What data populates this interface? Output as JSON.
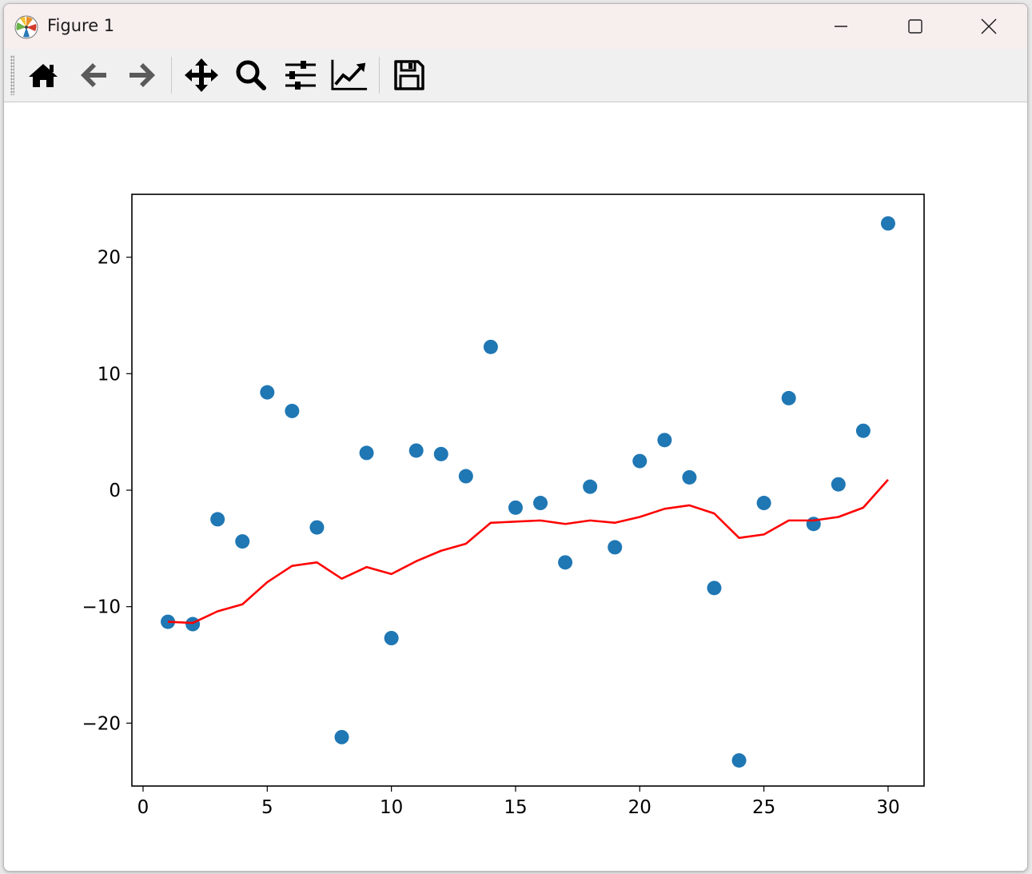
{
  "window": {
    "title": "Figure 1",
    "controls": {
      "minimize": "minimize",
      "maximize": "maximize",
      "close": "close"
    }
  },
  "toolbar": {
    "tools": [
      {
        "id": "home",
        "icon": "home-icon"
      },
      {
        "id": "back",
        "icon": "arrow-left-icon"
      },
      {
        "id": "forward",
        "icon": "arrow-right-icon"
      },
      {
        "id": "pan",
        "icon": "move-icon"
      },
      {
        "id": "zoom",
        "icon": "magnifier-icon"
      },
      {
        "id": "subplots",
        "icon": "sliders-icon"
      },
      {
        "id": "axes",
        "icon": "chart-line-icon"
      },
      {
        "id": "save",
        "icon": "floppy-disk-icon"
      }
    ]
  },
  "chart_data": {
    "type": "scatter",
    "title": "",
    "xlabel": "",
    "ylabel": "",
    "xlim": [
      -0.45,
      31.45
    ],
    "ylim": [
      -25.4,
      25.4
    ],
    "xticks": [
      0,
      5,
      10,
      15,
      20,
      25,
      30
    ],
    "yticks": [
      -20,
      -10,
      0,
      10,
      20
    ],
    "xtick_labels": [
      "0",
      "5",
      "10",
      "15",
      "20",
      "25",
      "30"
    ],
    "ytick_labels": [
      "−20",
      "−10",
      "0",
      "10",
      "20"
    ],
    "grid": false,
    "series": [
      {
        "type": "scatter",
        "color": "#1f77b4",
        "x": [
          1,
          2,
          3,
          4,
          5,
          6,
          7,
          8,
          9,
          10,
          11,
          12,
          13,
          14,
          15,
          16,
          17,
          18,
          19,
          20,
          21,
          22,
          23,
          24,
          25,
          26,
          27,
          28,
          29,
          30
        ],
        "y": [
          -11.3,
          -11.5,
          -2.5,
          -4.4,
          8.4,
          6.8,
          -3.2,
          -21.2,
          3.2,
          -12.7,
          3.4,
          3.1,
          1.2,
          12.3,
          -1.5,
          -1.1,
          -6.2,
          0.3,
          -4.9,
          2.5,
          4.3,
          1.1,
          -8.4,
          -23.2,
          -1.1,
          7.9,
          -2.9,
          0.5,
          5.1,
          22.9
        ]
      },
      {
        "type": "line",
        "color": "#ff0000",
        "x": [
          1,
          2,
          3,
          4,
          5,
          6,
          7,
          8,
          9,
          10,
          11,
          12,
          13,
          14,
          15,
          16,
          17,
          18,
          19,
          20,
          21,
          22,
          23,
          24,
          25,
          26,
          27,
          28,
          29,
          30
        ],
        "y": [
          -11.3,
          -11.4,
          -10.4,
          -9.8,
          -7.9,
          -6.5,
          -6.2,
          -7.6,
          -6.6,
          -7.2,
          -6.1,
          -5.2,
          -4.6,
          -2.8,
          -2.7,
          -2.6,
          -2.9,
          -2.6,
          -2.8,
          -2.3,
          -1.6,
          -1.3,
          -2.0,
          -4.1,
          -3.8,
          -2.6,
          -2.6,
          -2.3,
          -1.5,
          0.9
        ]
      }
    ]
  }
}
